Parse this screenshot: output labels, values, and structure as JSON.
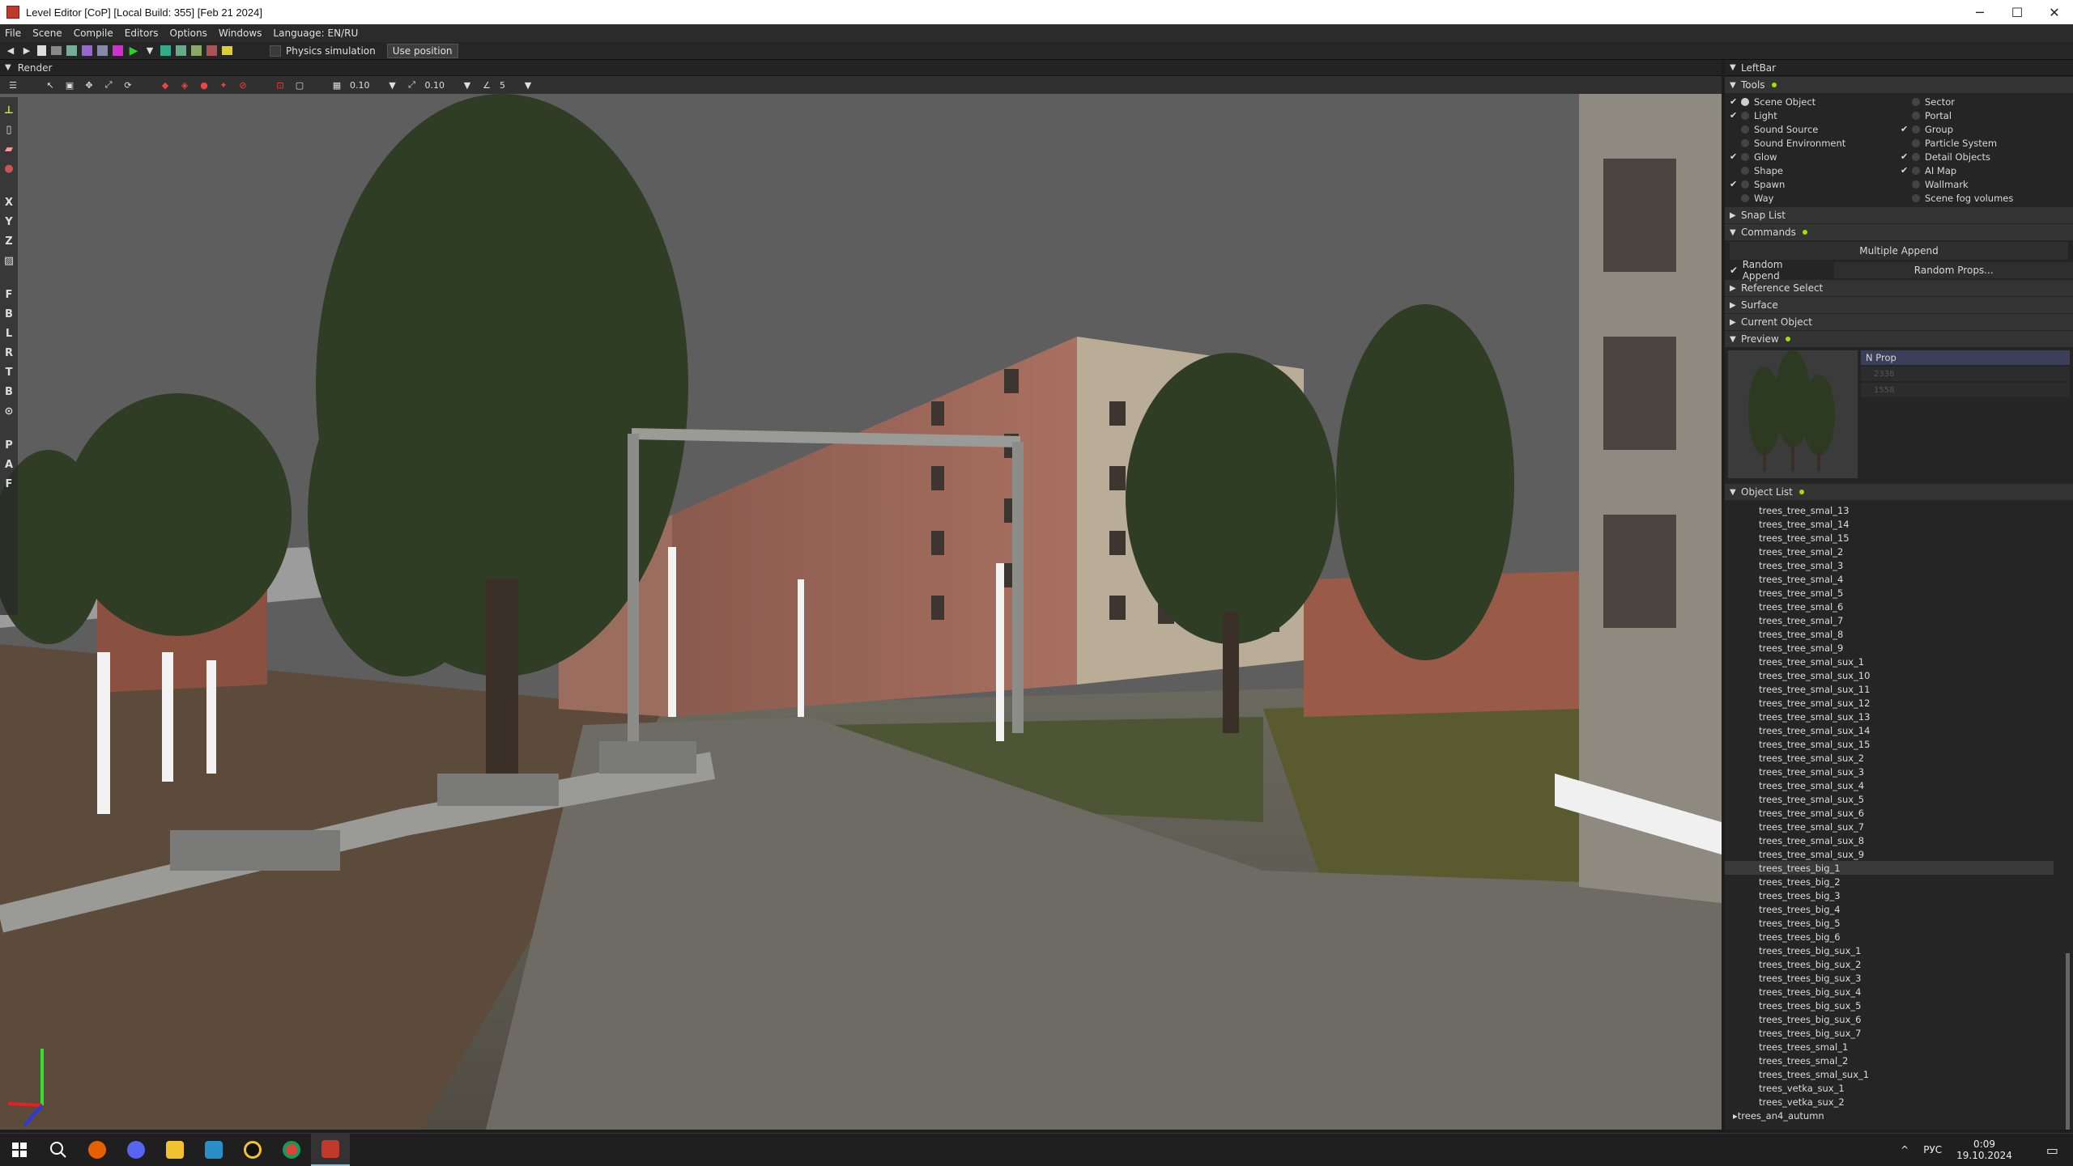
{
  "window": {
    "title": "Level Editor [CoP] [Local Build: 355] [Feb 21 2024]",
    "minimize": "─",
    "maximize": "☐",
    "close": "✕"
  },
  "menu": [
    "File",
    "Scene",
    "Compile",
    "Editors",
    "Options",
    "Windows",
    "Language: EN/RU"
  ],
  "toolbar": {
    "physics_label": "Physics simulation",
    "use_position_label": "Use position"
  },
  "render_panel": {
    "title": "Render"
  },
  "viewport_toolbar": {
    "grid_value": "0.10",
    "scale_value": "0.10",
    "angle_value": "5"
  },
  "side_tools": [
    "F",
    "B",
    "L",
    "R",
    "T",
    "B",
    "P",
    "A",
    "F"
  ],
  "axis_tools": [
    "X",
    "Y",
    "Z"
  ],
  "leftbar": {
    "title": "LeftBar",
    "tools_label": "Tools",
    "tools_left": [
      {
        "label": "Scene Object",
        "checked": true,
        "active": true
      },
      {
        "label": "Light",
        "checked": true,
        "active": false
      },
      {
        "label": "Sound Source",
        "checked": false,
        "active": false
      },
      {
        "label": "Sound Environment",
        "checked": false,
        "active": false
      },
      {
        "label": "Glow",
        "checked": true,
        "active": false
      },
      {
        "label": "Shape",
        "checked": false,
        "active": false
      },
      {
        "label": "Spawn",
        "checked": true,
        "active": false
      },
      {
        "label": "Way",
        "checked": false,
        "active": false
      }
    ],
    "tools_right": [
      {
        "label": "Sector",
        "checked": false,
        "active": false
      },
      {
        "label": "Portal",
        "checked": false,
        "active": false
      },
      {
        "label": "Group",
        "checked": true,
        "active": false
      },
      {
        "label": "Particle System",
        "checked": false,
        "active": false
      },
      {
        "label": "Detail Objects",
        "checked": true,
        "active": false
      },
      {
        "label": "AI Map",
        "checked": true,
        "active": false
      },
      {
        "label": "Wallmark",
        "checked": false,
        "active": false
      },
      {
        "label": "Scene fog volumes",
        "checked": false,
        "active": false
      }
    ],
    "snap_list": "Snap List",
    "commands": "Commands",
    "multiple_append": "Multiple Append",
    "random_append": "Random Append",
    "random_props": "Random Props...",
    "reference_select": "Reference Select",
    "surface": "Surface",
    "current_object": "Current Object",
    "preview": "Preview",
    "preview_props": {
      "n_prop": "N Prop",
      "v1": "2338",
      "v2": "1558"
    },
    "object_list": "Object List",
    "objects": [
      "trees_tree_smal_13",
      "trees_tree_smal_14",
      "trees_tree_smal_15",
      "trees_tree_smal_2",
      "trees_tree_smal_3",
      "trees_tree_smal_4",
      "trees_tree_smal_5",
      "trees_tree_smal_6",
      "trees_tree_smal_7",
      "trees_tree_smal_8",
      "trees_tree_smal_9",
      "trees_tree_smal_sux_1",
      "trees_tree_smal_sux_10",
      "trees_tree_smal_sux_11",
      "trees_tree_smal_sux_12",
      "trees_tree_smal_sux_13",
      "trees_tree_smal_sux_14",
      "trees_tree_smal_sux_15",
      "trees_tree_smal_sux_2",
      "trees_tree_smal_sux_3",
      "trees_tree_smal_sux_4",
      "trees_tree_smal_sux_5",
      "trees_tree_smal_sux_6",
      "trees_tree_smal_sux_7",
      "trees_tree_smal_sux_8",
      "trees_tree_smal_sux_9",
      "trees_trees_big_1",
      "trees_trees_big_2",
      "trees_trees_big_3",
      "trees_trees_big_4",
      "trees_trees_big_5",
      "trees_trees_big_6",
      "trees_trees_big_sux_1",
      "trees_trees_big_sux_2",
      "trees_trees_big_sux_3",
      "trees_trees_big_sux_4",
      "trees_trees_big_sux_5",
      "trees_trees_big_sux_6",
      "trees_trees_big_sux_7",
      "trees_trees_smal_1",
      "trees_trees_smal_2",
      "trees_trees_smal_sux_1",
      "trees_vetka_sux_1",
      "trees_vetka_sux_2"
    ],
    "selected_object": "trees_trees_big_1",
    "parent_group": "trees_an4_autumn"
  },
  "taskbar": {
    "lang": "РУС",
    "time": "0:09",
    "date": "19.10.2024",
    "up_arrow": "^"
  }
}
